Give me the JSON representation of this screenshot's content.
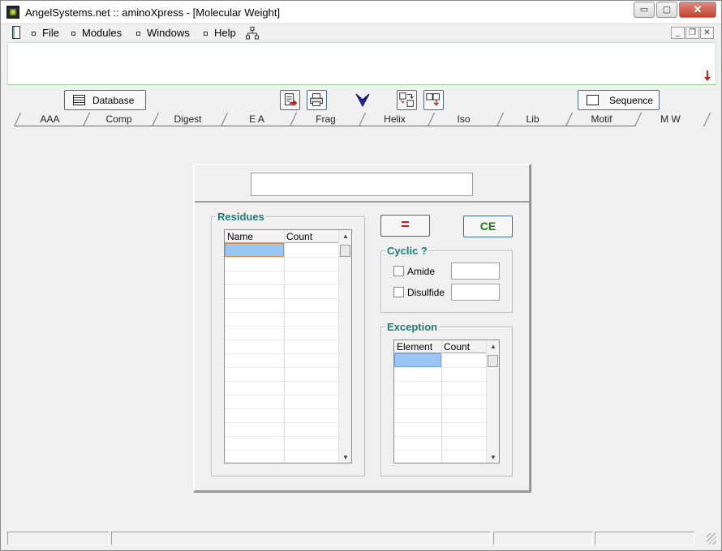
{
  "window": {
    "title": "AngelSystems.net :: aminoXpress - [Molecular Weight]",
    "controls": {
      "minimize": "▭",
      "maximize": "▢",
      "close": "✕"
    }
  },
  "menu": {
    "items": [
      "File",
      "Modules",
      "Windows",
      "Help"
    ],
    "mdi_controls": {
      "minimize": "_",
      "restore": "❐",
      "close": "✕"
    }
  },
  "toolbar": {
    "database_label": "Database",
    "sequence_label": "Sequence"
  },
  "tabs": [
    "AAA",
    "Comp",
    "Digest",
    "E A",
    "Frag",
    "Helix",
    "Iso",
    "Lib",
    "Motif",
    "M W"
  ],
  "active_tab": "M W",
  "dialog": {
    "formula_value": "",
    "residues": {
      "title": "Residues",
      "columns": [
        "Name",
        "Count"
      ]
    },
    "equals_label": "=",
    "ce_label": "CE",
    "cyclic": {
      "title": "Cyclic ?",
      "amide_label": "Amide",
      "disulfide_label": "Disulfide",
      "amide_value": "",
      "disulfide_value": ""
    },
    "exception": {
      "title": "Exception",
      "columns": [
        "Element",
        "Count"
      ]
    }
  },
  "colors": {
    "group_title": "#1e7b7b",
    "equals_red": "#d01818",
    "ce_green": "#1a7a1a",
    "selection": "#99c6f5"
  }
}
